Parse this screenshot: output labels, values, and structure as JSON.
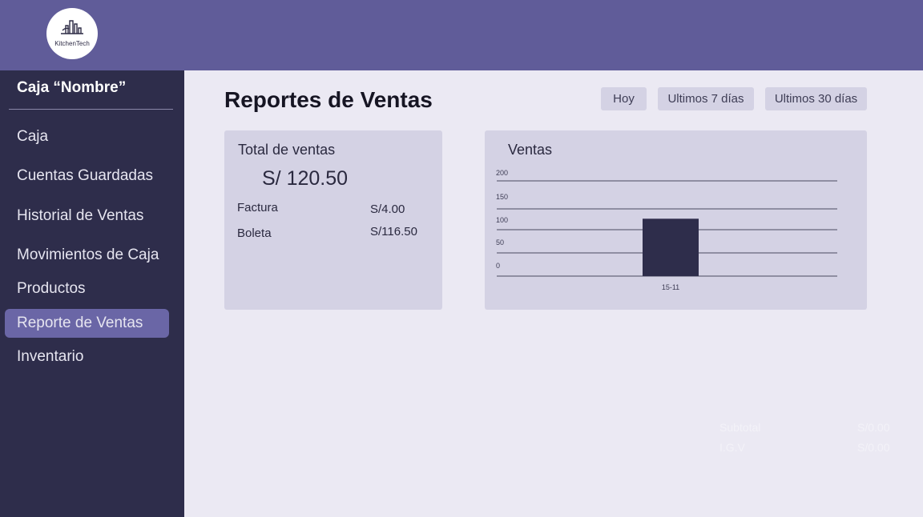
{
  "brand": {
    "name": "KitchenTech",
    "icon": "kitchen-building-icon"
  },
  "sidebar": {
    "title": "Caja “Nombre”",
    "items": [
      {
        "label": "Caja",
        "active": false
      },
      {
        "label": "Cuentas Guardadas",
        "active": false
      },
      {
        "label": "Historial de Ventas",
        "active": false
      },
      {
        "label": "Movimientos de Caja",
        "active": false
      },
      {
        "label": "Productos",
        "active": false
      },
      {
        "label": "Reporte de Ventas",
        "active": true
      },
      {
        "label": "Inventario",
        "active": false
      }
    ]
  },
  "main": {
    "title": "Reportes de Ventas",
    "ranges": [
      "Hoy",
      "Ultimos 7 días",
      "Ultimos 30 días"
    ],
    "totals": {
      "label": "Total de ventas",
      "amount": "S/ 120.50",
      "rows": [
        {
          "label": "Factura",
          "value": "S/4.00"
        },
        {
          "label": "Boleta",
          "value": "S/116.50"
        }
      ]
    },
    "ghost_summary": [
      {
        "label": "Subtotal",
        "value": "S/0.00"
      },
      {
        "label": "I.G.V",
        "value": "S/0.00"
      }
    ]
  },
  "colors": {
    "header": "#605c99",
    "sidebar": "#2e2d4b",
    "active": "#6a66a6",
    "bar": "#2e2d4b",
    "card": "#d4d2e4"
  },
  "chart_data": {
    "type": "bar",
    "title": "Ventas",
    "categories": [
      "15-11"
    ],
    "values": [
      120.5
    ],
    "yticks": [
      "200",
      "150",
      "100",
      "50",
      "0"
    ],
    "ylim": [
      0,
      200
    ],
    "grid": true
  }
}
